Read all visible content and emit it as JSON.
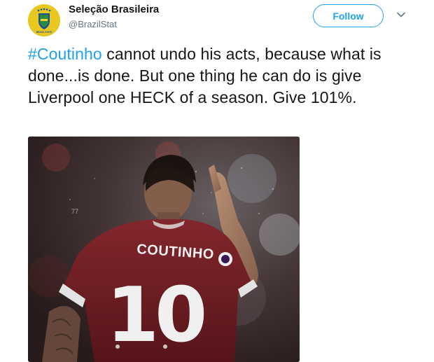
{
  "account": {
    "display_name": "Seleção Brasileira",
    "handle": "@BrazilStat",
    "avatar_text": "BRAZIL STATS"
  },
  "actions": {
    "follow_label": "Follow",
    "menu_icon": "chevron-down-icon"
  },
  "tweet": {
    "hashtag": "#Coutinho",
    "text_after_hashtag": " cannot undo his acts, because what is done...is done. But one thing he can do is give Liverpool one HECK of a season. Give 101%."
  },
  "photo": {
    "shirt_name": "COUTINHO",
    "shirt_number": "10",
    "background_number": "77"
  },
  "colors": {
    "accent": "#1da1f2",
    "text": "#14171a",
    "secondary_text": "#657786",
    "jersey": "#7a1f25"
  }
}
